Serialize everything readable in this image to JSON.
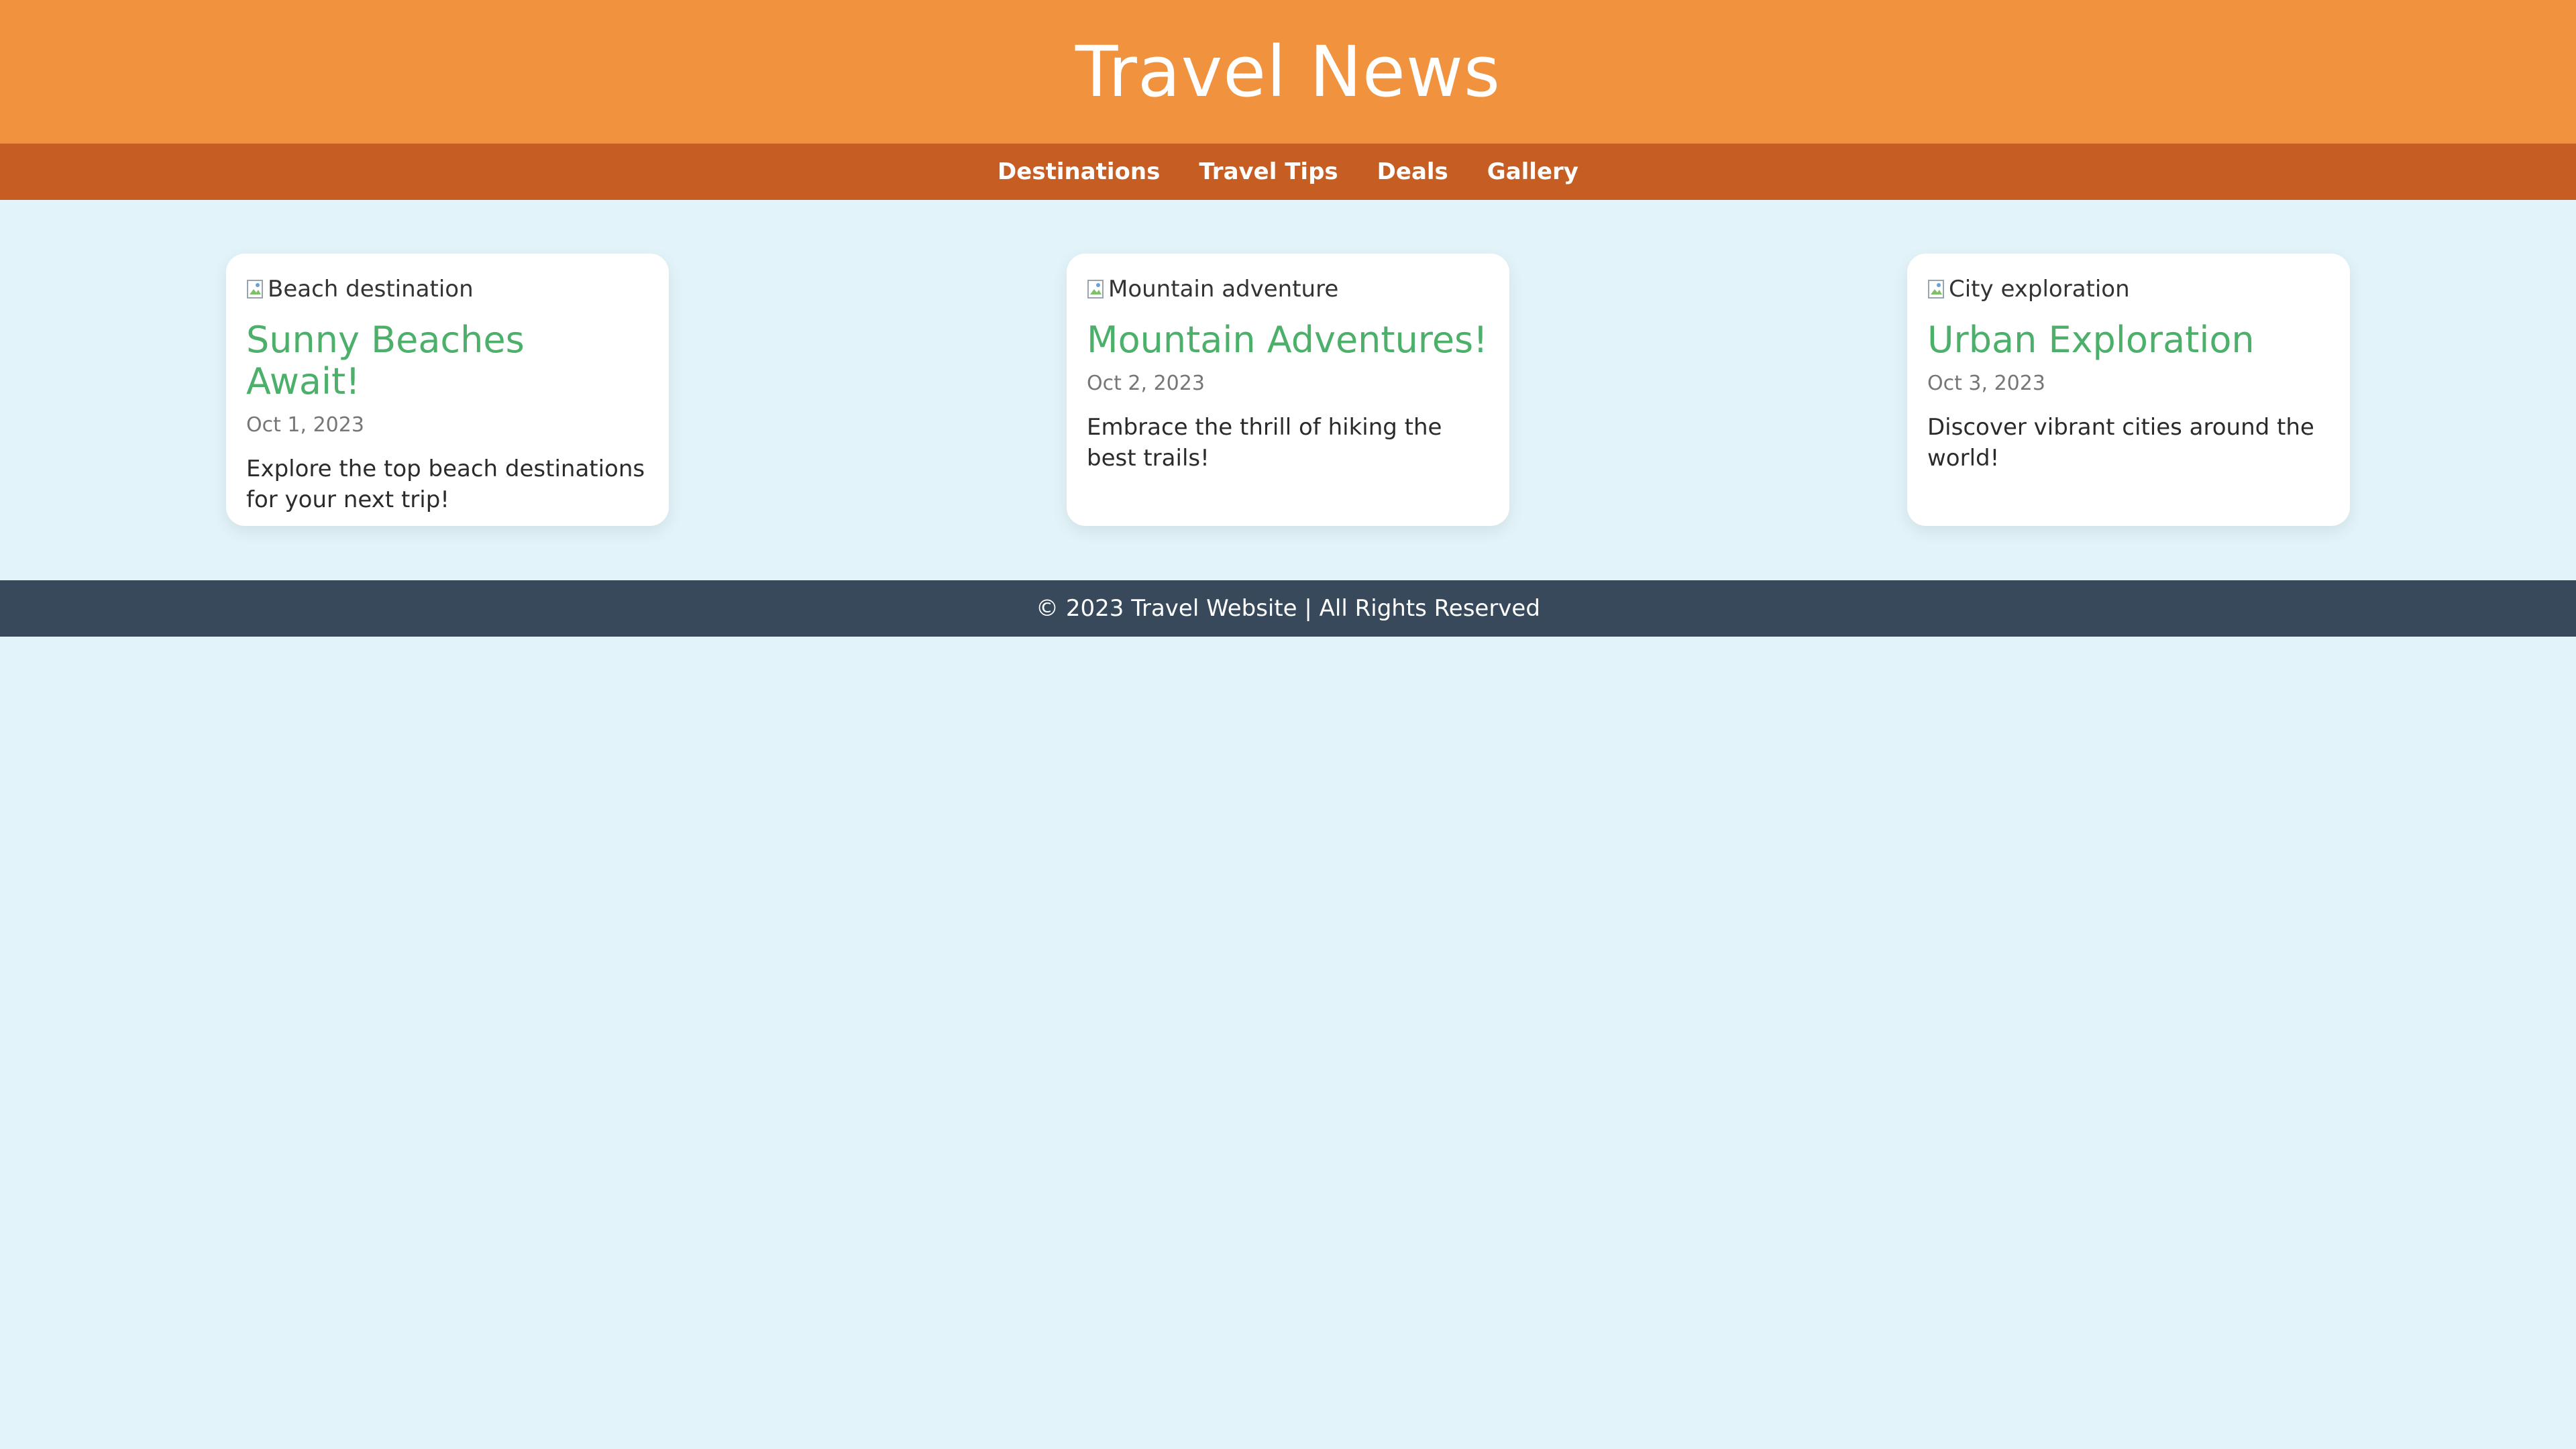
{
  "header": {
    "title": "Travel News"
  },
  "nav": {
    "items": [
      {
        "label": "Destinations"
      },
      {
        "label": "Travel Tips"
      },
      {
        "label": "Deals"
      },
      {
        "label": "Gallery"
      }
    ]
  },
  "articles": [
    {
      "image_alt": "Beach destination",
      "title": "Sunny Beaches Await!",
      "date": "Oct 1, 2023",
      "text": "Explore the top beach destinations for your next trip!"
    },
    {
      "image_alt": "Mountain adventure",
      "title": "Mountain Adventures!",
      "date": "Oct 2, 2023",
      "text": "Embrace the thrill of hiking the best trails!"
    },
    {
      "image_alt": "City exploration",
      "title": "Urban Exploration",
      "date": "Oct 3, 2023",
      "text": "Discover vibrant cities around the world!"
    }
  ],
  "footer": {
    "text": "© 2023 Travel Website | All Rights Reserved"
  },
  "colors": {
    "header_bg": "#f0923e",
    "nav_bg": "#c65d23",
    "page_bg": "#e2f4f9",
    "card_title": "#4caf6a",
    "footer_bg": "#37495b"
  },
  "icons": {
    "broken_image": "broken-image-icon"
  }
}
